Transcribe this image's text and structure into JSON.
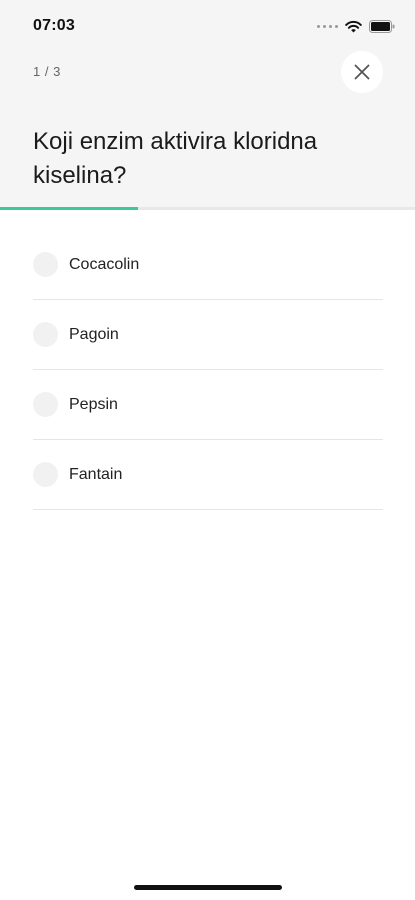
{
  "status_bar": {
    "time": "07:03",
    "icons": [
      "signal-dots-icon",
      "wifi-icon",
      "battery-icon"
    ]
  },
  "quiz": {
    "progress_label": "1 / 3",
    "progress_fraction": 0.333,
    "question": "Koji enzim aktivira kloridna kiselina?",
    "close_icon": "close-icon",
    "options": [
      {
        "label": "Cocacolin"
      },
      {
        "label": "Pagoin"
      },
      {
        "label": "Pepsin"
      },
      {
        "label": "Fantain"
      }
    ]
  },
  "colors": {
    "accent": "#3cc79c",
    "header_background": "#f5f5f5"
  }
}
